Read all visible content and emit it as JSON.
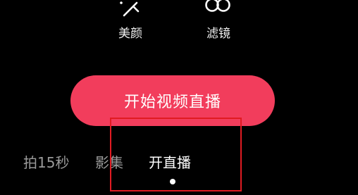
{
  "tools": {
    "beauty": {
      "label": "美颜",
      "icon": "magic-wand-icon"
    },
    "filter": {
      "label": "滤镜",
      "icon": "filter-circles-icon"
    }
  },
  "main_button": {
    "label": "开始视频直播",
    "color": "#f23d5c"
  },
  "mode_tabs": {
    "items": [
      {
        "label": "拍15秒",
        "active": false
      },
      {
        "label": "影集",
        "active": false
      },
      {
        "label": "开直播",
        "active": true
      }
    ],
    "active_color": "#ffffff",
    "inactive_color": "#9a9a9a"
  },
  "annotation": {
    "box_color": "#e11b22"
  }
}
